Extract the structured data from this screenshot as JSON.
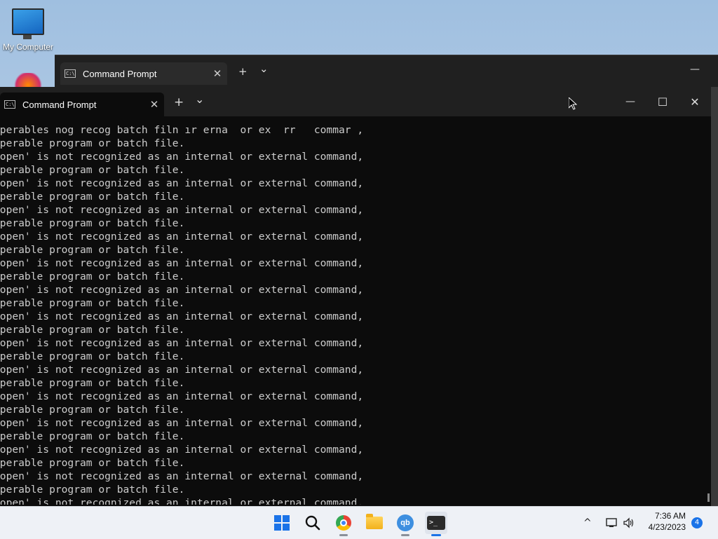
{
  "desktop": {
    "icons": [
      {
        "label": "My Computer",
        "icon": "my-computer-icon"
      }
    ]
  },
  "back_window": {
    "tab_label": "Command Prompt",
    "new_tab": "+",
    "dropdown": "⌄",
    "minimize": "—"
  },
  "window": {
    "tab_label": "Command Prompt",
    "tab_close": "✕",
    "new_tab": "+",
    "dropdown": "⌄",
    "minimize": "—",
    "maximize": "☐",
    "close": "✕",
    "console_lines": [
      "operables nog recog batch filn ır erna  or ex  rr   commar ,",
      "operable program or batch file.",
      "'open' is not recognized as an internal or external command,",
      "operable program or batch file.",
      "'open' is not recognized as an internal or external command,",
      "operable program or batch file.",
      "'open' is not recognized as an internal or external command,",
      "operable program or batch file.",
      "'open' is not recognized as an internal or external command,",
      "operable program or batch file.",
      "'open' is not recognized as an internal or external command,",
      "operable program or batch file.",
      "'open' is not recognized as an internal or external command,",
      "operable program or batch file.",
      "'open' is not recognized as an internal or external command,",
      "operable program or batch file.",
      "'open' is not recognized as an internal or external command,",
      "operable program or batch file.",
      "'open' is not recognized as an internal or external command,",
      "operable program or batch file.",
      "'open' is not recognized as an internal or external command,",
      "operable program or batch file.",
      "'open' is not recognized as an internal or external command,",
      "operable program or batch file.",
      "'open' is not recognized as an internal or external command,",
      "operable program or batch file.",
      "'open' is not recognized as an internal or external command,",
      "operable program or batch file.",
      "'open' is not recognized as an internal or external command,"
    ]
  },
  "taskbar": {
    "items": [
      "start-icon",
      "search-icon",
      "chrome-icon",
      "file-explorer-icon",
      "qbittorrent-icon",
      "terminal-icon"
    ],
    "qb_text": "qb",
    "term_text": ">_",
    "tray_chevron": "^",
    "clock_time": "7:36 AM",
    "clock_date": "4/23/2023",
    "notification_count": "4"
  }
}
